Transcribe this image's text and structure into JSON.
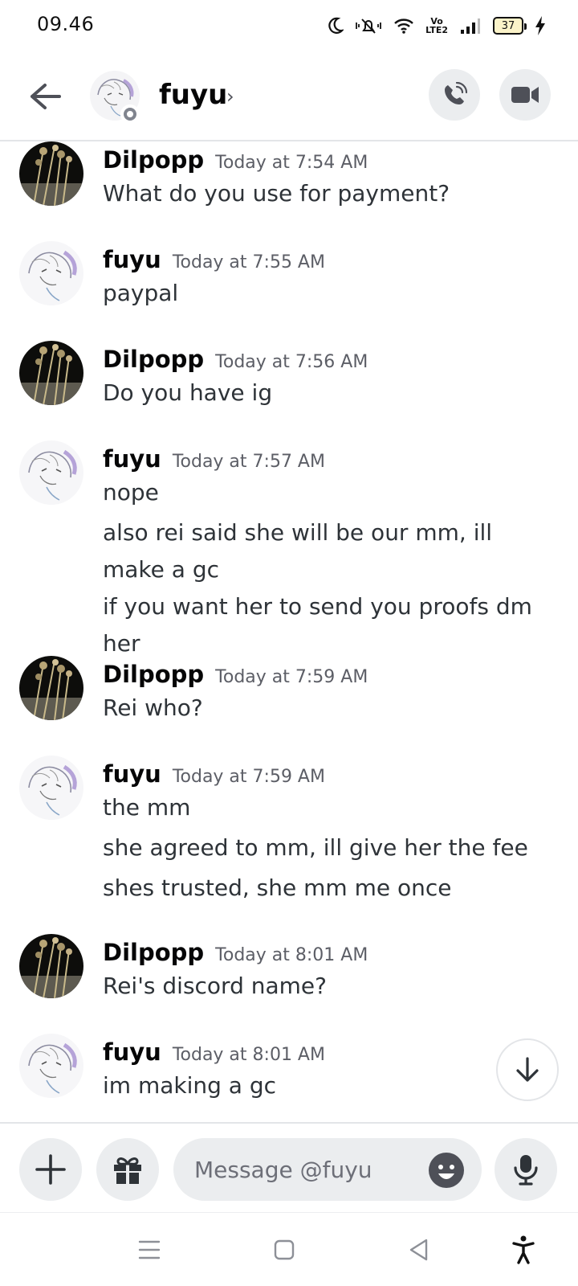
{
  "status_bar": {
    "time": "09.46",
    "battery": "37",
    "network_label_top": "Vo",
    "network_label_bottom": "LTE2"
  },
  "header": {
    "name": "fuyu",
    "chevron": "›"
  },
  "messages": [
    {
      "author": "Dilpopp",
      "timestamp": "Today at 7:54 AM",
      "avatar": "photo-avatar",
      "lines": [
        "What do you use for payment?"
      ]
    },
    {
      "author": "fuyu",
      "timestamp": "Today at 7:55 AM",
      "avatar": "anime-sketch-avatar",
      "lines": [
        "paypal"
      ]
    },
    {
      "author": "Dilpopp",
      "timestamp": "Today at 7:56 AM",
      "avatar": "photo-avatar",
      "lines": [
        "Do you have ig"
      ]
    },
    {
      "author": "fuyu",
      "timestamp": "Today at 7:57 AM",
      "avatar": "anime-sketch-avatar",
      "lines": [
        "nope",
        "also rei said she will be our mm, ill make a gc",
        "if you want her to send you proofs dm her"
      ]
    },
    {
      "author": "Dilpopp",
      "timestamp": "Today at 7:59 AM",
      "avatar": "photo-avatar",
      "lines": [
        "Rei who?"
      ]
    },
    {
      "author": "fuyu",
      "timestamp": "Today at 7:59 AM",
      "avatar": "anime-sketch-avatar",
      "lines": [
        "the mm",
        "she agreed to mm, ill give her the fee",
        "shes trusted, she mm me once"
      ]
    },
    {
      "author": "Dilpopp",
      "timestamp": "Today at 8:01 AM",
      "avatar": "photo-avatar",
      "lines": [
        "Rei's discord name?"
      ]
    },
    {
      "author": "fuyu",
      "timestamp": "Today at 8:01 AM",
      "avatar": "anime-sketch-avatar",
      "lines": [
        "im making a gc"
      ]
    }
  ],
  "composer": {
    "placeholder": "Message @fuyu"
  },
  "icons": {
    "back": "arrow-left-icon",
    "call": "phone-icon",
    "video": "video-camera-icon",
    "jump": "arrow-down-icon",
    "plus": "plus-icon",
    "gift": "gift-icon",
    "emoji": "emoji-icon",
    "mic": "microphone-icon"
  }
}
